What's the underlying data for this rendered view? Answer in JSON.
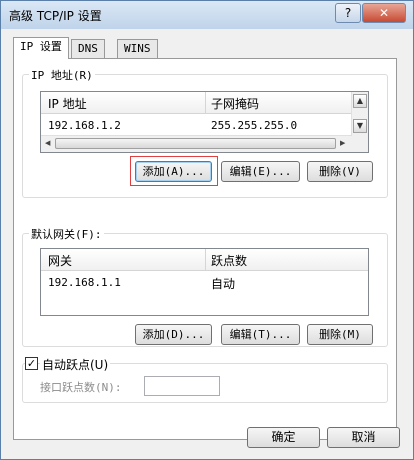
{
  "window": {
    "title": "高级 TCP/IP 设置",
    "help_label": "?",
    "close_label": "✕"
  },
  "tabs": [
    {
      "label": "IP 设置"
    },
    {
      "label": "DNS"
    },
    {
      "label": "WINS"
    }
  ],
  "ip_section": {
    "label": "IP 地址(R)",
    "columns": [
      "IP 地址",
      "子网掩码"
    ],
    "rows": [
      {
        "ip": "192.168.1.2",
        "mask": "255.255.255.0"
      }
    ],
    "buttons": {
      "add": "添加(A)...",
      "edit": "编辑(E)...",
      "delete": "删除(V)"
    }
  },
  "gateway_section": {
    "label": "默认网关(F):",
    "columns": [
      "网关",
      "跃点数"
    ],
    "rows": [
      {
        "gateway": "192.168.1.1",
        "metric": "自动"
      }
    ],
    "buttons": {
      "add": "添加(D)...",
      "edit": "编辑(T)...",
      "delete": "删除(M)"
    }
  },
  "auto_metric": {
    "label": "自动跃点(U)",
    "checked": true,
    "mark": "✓"
  },
  "interface_metric": {
    "label": "接口跃点数(N):",
    "value": ""
  },
  "footer": {
    "ok": "确定",
    "cancel": "取消"
  },
  "icons": {
    "scroll_up": "▲",
    "scroll_down": "▼",
    "scroll_left": "◀",
    "scroll_right": "▶"
  },
  "colors": {
    "title_gradient": "#bfd3ea",
    "close": "#c74a33",
    "highlight": "#e04040"
  }
}
